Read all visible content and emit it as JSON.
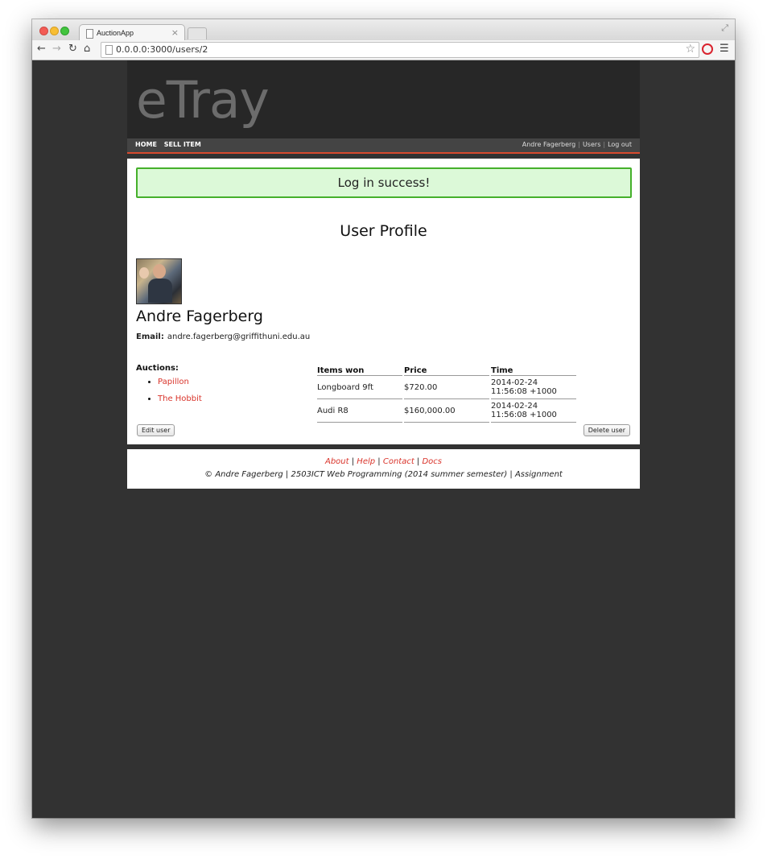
{
  "browser": {
    "tab_title": "AuctionApp",
    "url": "0.0.0.0:3000/users/2"
  },
  "site": {
    "logo": "eTray",
    "nav_left": [
      "HOME",
      "SELL ITEM"
    ],
    "nav_right": [
      "Andre Fagerberg",
      "Users",
      "Log out"
    ]
  },
  "flash": "Log in success!",
  "profile": {
    "title": "User Profile",
    "name": "Andre Fagerberg",
    "email_label": "Email:",
    "email": "andre.fagerberg@griffithuni.edu.au",
    "auctions_label": "Auctions:",
    "auctions": [
      "Papillon",
      "The Hobbit"
    ]
  },
  "won_table": {
    "headers": [
      "Items won",
      "Price",
      "Time"
    ],
    "rows": [
      [
        "Longboard 9ft",
        "$720.00",
        "2014-02-24 11:56:08 +1000"
      ],
      [
        "Audi R8",
        "$160,000.00",
        "2014-02-24 11:56:08 +1000"
      ]
    ]
  },
  "buttons": {
    "edit": "Edit user",
    "delete": "Delete user"
  },
  "footer": {
    "links": [
      "About",
      "Help",
      "Contact",
      "Docs"
    ],
    "copyright": "© Andre Fagerberg | 2503ICT Web Programming (2014 summer semester) | Assignment"
  },
  "colors": {
    "accent": "#d9342b",
    "flash_bg": "#dcf9d8",
    "flash_border": "#45b02b",
    "page_bg": "#323232"
  }
}
